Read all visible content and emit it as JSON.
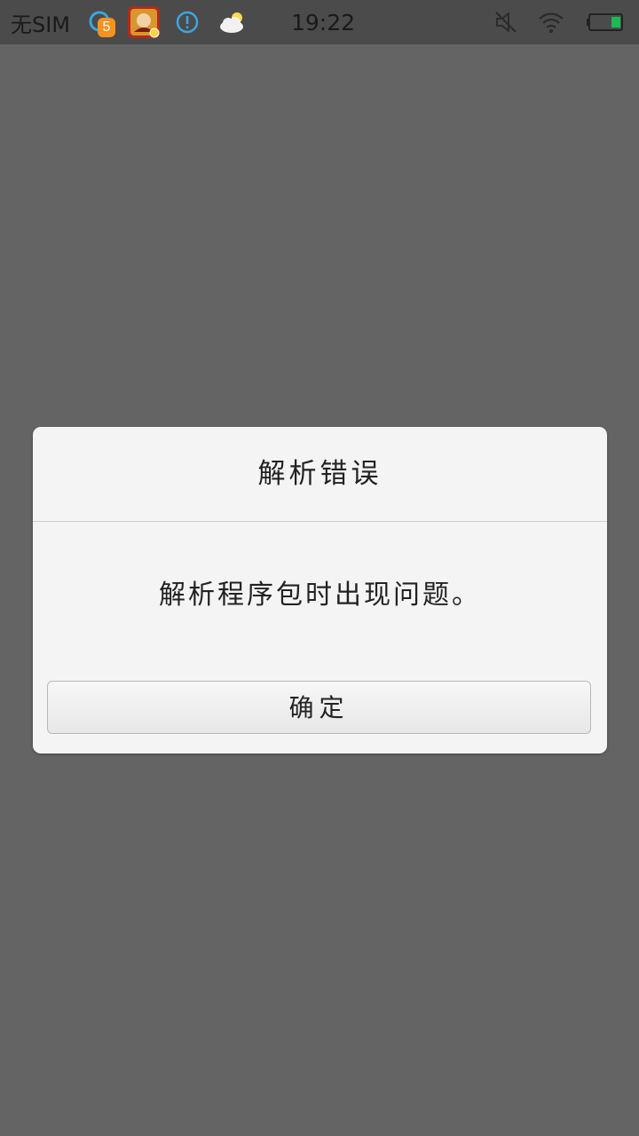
{
  "status_bar": {
    "carrier": "无SIM",
    "time": "19:22",
    "notification_badge": "5",
    "icons": [
      "qq-notification-icon",
      "game-app-icon",
      "alert-icon",
      "weather-icon",
      "mute-icon",
      "wifi-icon",
      "battery-icon"
    ],
    "battery_color": "#1db954"
  },
  "dialog": {
    "title": "解析错误",
    "message": "解析程序包时出现问题。",
    "ok_button": "确定"
  },
  "colors": {
    "background": "#646464",
    "dialog_bg": "#f4f4f4",
    "icon_blue": "#3aa6e0",
    "badge_orange": "#f6921e"
  }
}
